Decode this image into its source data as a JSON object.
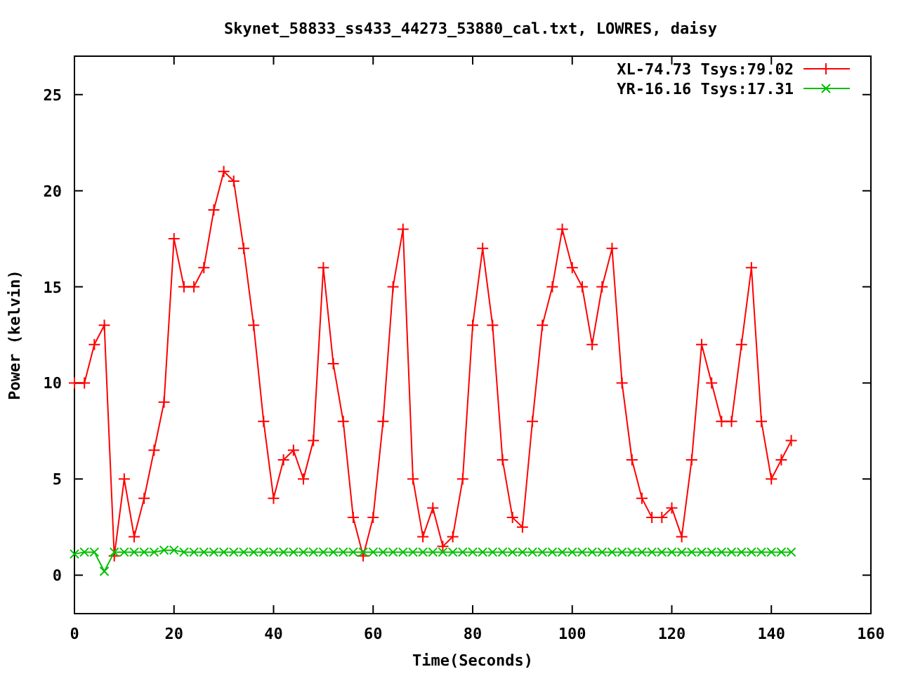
{
  "chart_data": {
    "type": "line",
    "title": "Skynet_58833_ss433_44273_53880_cal.txt, LOWRES, daisy",
    "xlabel": "Time(Seconds)",
    "ylabel": "Power (kelvin)",
    "x": [
      0,
      2,
      4,
      6,
      8,
      10,
      12,
      14,
      16,
      18,
      20,
      22,
      24,
      26,
      28,
      30,
      32,
      34,
      36,
      38,
      40,
      42,
      44,
      46,
      48,
      50,
      52,
      54,
      56,
      58,
      60,
      62,
      64,
      66,
      68,
      70,
      72,
      74,
      76,
      78,
      80,
      82,
      84,
      86,
      88,
      90,
      92,
      94,
      96,
      98,
      100,
      102,
      104,
      106,
      108,
      110,
      112,
      114,
      116,
      118,
      120,
      122,
      124,
      126,
      128,
      130,
      132,
      134,
      136,
      138,
      140,
      142,
      144
    ],
    "series": [
      {
        "name": "XL-74.73 Tsys:79.02",
        "color": "#ff0000",
        "marker": "plus",
        "values": [
          10,
          10,
          12,
          13,
          1,
          5,
          2,
          4,
          6.5,
          9,
          17.5,
          15,
          15,
          16,
          19,
          21,
          20.5,
          17,
          13,
          8,
          4,
          6,
          6.5,
          5,
          7,
          16,
          11,
          8,
          3,
          1,
          3,
          8,
          15,
          18,
          5,
          2,
          3.5,
          1.5,
          2,
          5,
          13,
          17,
          13,
          6,
          3,
          2.5,
          8,
          13,
          15,
          18,
          16,
          15,
          12,
          15,
          17,
          10,
          6,
          4,
          3,
          3,
          3.5,
          2,
          6,
          12,
          10,
          8,
          8,
          12,
          16,
          8,
          5,
          6,
          7
        ]
      },
      {
        "name": "YR-16.16 Tsys:17.31",
        "color": "#00c000",
        "marker": "cross",
        "values": [
          1.1,
          1.2,
          1.2,
          0.2,
          1.2,
          1.2,
          1.2,
          1.2,
          1.2,
          1.3,
          1.3,
          1.2,
          1.2,
          1.2,
          1.2,
          1.2,
          1.2,
          1.2,
          1.2,
          1.2,
          1.2,
          1.2,
          1.2,
          1.2,
          1.2,
          1.2,
          1.2,
          1.2,
          1.2,
          1.2,
          1.2,
          1.2,
          1.2,
          1.2,
          1.2,
          1.2,
          1.2,
          1.2,
          1.2,
          1.2,
          1.2,
          1.2,
          1.2,
          1.2,
          1.2,
          1.2,
          1.2,
          1.2,
          1.2,
          1.2,
          1.2,
          1.2,
          1.2,
          1.2,
          1.2,
          1.2,
          1.2,
          1.2,
          1.2,
          1.2,
          1.2,
          1.2,
          1.2,
          1.2,
          1.2,
          1.2,
          1.2,
          1.2,
          1.2,
          1.2,
          1.2,
          1.2,
          1.2
        ]
      }
    ],
    "legend": true,
    "xlim": [
      0,
      160
    ],
    "ylim": [
      -2,
      27
    ],
    "xticks": [
      0,
      20,
      40,
      60,
      80,
      100,
      120,
      140,
      160
    ],
    "yticks": [
      0,
      5,
      10,
      15,
      20,
      25
    ]
  }
}
